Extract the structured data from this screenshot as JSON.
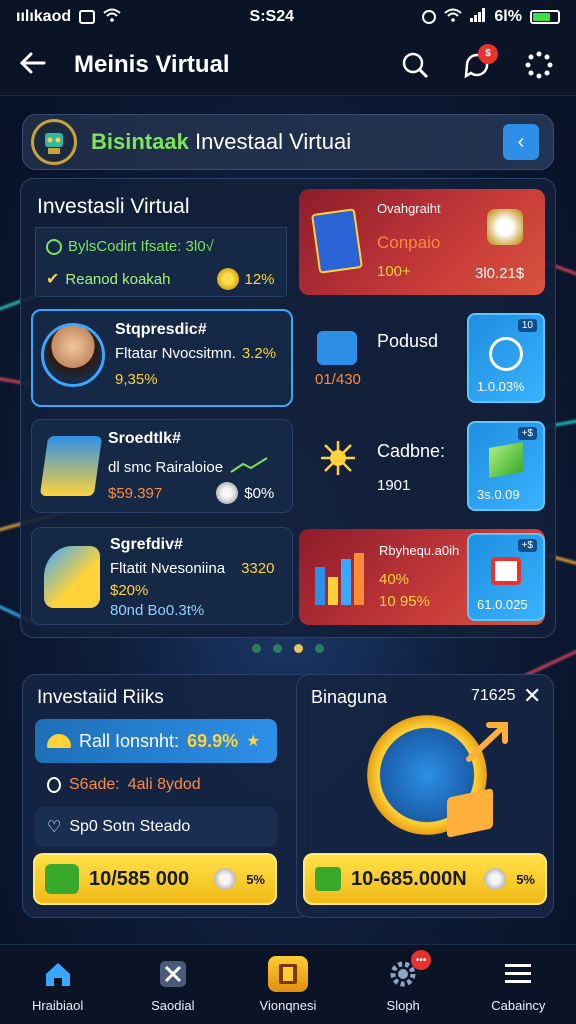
{
  "status_bar": {
    "carrier": "ıılıkaod",
    "time": "S:S24",
    "battery": "6l%"
  },
  "header": {
    "title": "Meinis Virtual"
  },
  "banner": {
    "accent": "Bisintaak",
    "text": "Investaal Virtuai"
  },
  "grid": {
    "c1": {
      "title": "Investasli Virtual",
      "line1": "BylsCodirt Ifsate: 3l0√",
      "line2": "Reanod koakah",
      "value2": "12%"
    },
    "c2": {
      "title": "Ovahgraiht",
      "sub": "Conpaio",
      "value": "100+",
      "amount": "3l0.21$"
    },
    "c3": {
      "title": "Stqpresdic#",
      "line1": "Fltatar Nvocsitmn.",
      "pct1": "3.2%",
      "line2": "9,35%"
    },
    "c4": {
      "title": "Podusd",
      "value": "01/430",
      "badge": "10",
      "amount": "1.0.03%"
    },
    "c5": {
      "title": "Sroedtlk#",
      "line1": "dl smc Rairaloioe",
      "line2": "$59.397",
      "badge": "$0%"
    },
    "c6": {
      "title": "Cadbne:",
      "value": "1901",
      "amount": "3s.0.09",
      "badge": "+$"
    },
    "c7": {
      "title": "Sgrefdiv#",
      "line1": "Fltatit Nvesoniina",
      "pct1": "3320",
      "line2": "$20%",
      "line3": "80nd Bo0.3t%"
    },
    "c8": {
      "title": "Rbyhequ.a0ih",
      "pct": "40%",
      "sub": "10 95%",
      "amount": "61.0.025",
      "badge": "+$"
    }
  },
  "risk_card": {
    "title": "Investaiid Riiks",
    "row1": "Rall Ionsnht:",
    "row1_value": "69.9%",
    "row2_label": "S6ade:",
    "row2_value": "4ali 8ydod",
    "row3": "Sp0 Sotn Steado",
    "button": "10/585 000",
    "button_badge": "5%"
  },
  "bonus_card": {
    "title": "Binaguna",
    "counter": "71625",
    "button": "10-685.000N",
    "button_badge": "5%"
  },
  "nav": {
    "items": [
      {
        "label": "Hraibiaol",
        "icon": "home-icon"
      },
      {
        "label": "Saodial",
        "icon": "tools-icon"
      },
      {
        "label": "Vionqnesi",
        "icon": "book-icon"
      },
      {
        "label": "Sloph",
        "icon": "gear-icon",
        "badge": "•••"
      },
      {
        "label": "Cabaincy",
        "icon": "menu-icon"
      }
    ]
  },
  "colors": {
    "accent_green": "#7fe35c",
    "accent_yellow": "#ffd23a",
    "card_red": "#c63a3a",
    "card_blue": "#38b2ff",
    "background": "#0a1428"
  }
}
